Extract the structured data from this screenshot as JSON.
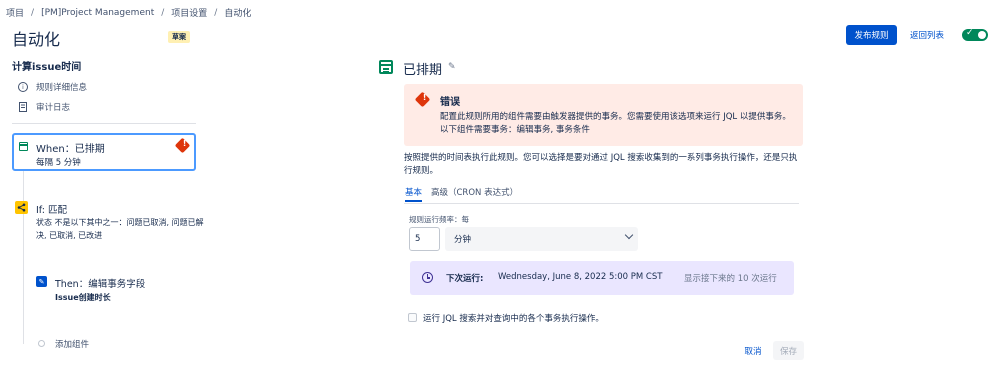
{
  "breadcrumb": {
    "items": [
      "项目",
      "[PM]Project Management",
      "项目设置",
      "自动化"
    ],
    "separator": "/"
  },
  "header": {
    "title": "自动化",
    "badge": "草案",
    "publish_label": "发布规则",
    "back_label": "返回列表",
    "toggle_on": true
  },
  "sidebar": {
    "rule_name": "计算issue时间",
    "links": [
      {
        "icon": "info-icon",
        "label": "规则详细信息"
      },
      {
        "icon": "document-icon",
        "label": "审计日志"
      }
    ],
    "components": {
      "when": {
        "title": "When：已排期",
        "sub": "每隔 5 分钟",
        "icon": "calendar-icon",
        "has_error": true
      },
      "if": {
        "title": "If: 匹配",
        "desc": "状态 不是以下其中之一：问题已取消, 问题已解决, 已取消, 已改进",
        "icon": "branch-icon"
      },
      "then": {
        "title": "Then：编辑事务字段",
        "desc": "Issue创建时长",
        "icon": "pencil-icon"
      },
      "add_label": "添加组件"
    }
  },
  "main": {
    "section_title": "已排期",
    "error": {
      "title": "错误",
      "message": "配置此规则所用的组件需要由触发器提供的事务。您需要使用该选项来运行 JQL 以提供事务。以下组件需要事务：编辑事务, 事务条件"
    },
    "description": "按照提供的时间表执行此规则。您可以选择是要对通过 JQL 搜索收集到的一系列事务执行操作，还是只执行规则。",
    "tabs": [
      {
        "label": "基本",
        "active": true
      },
      {
        "label": "高级（CRON 表达式）",
        "active": false
      }
    ],
    "frequency_label": "规则运行频率：每",
    "frequency_value": "5",
    "frequency_unit": "分钟",
    "next_run": {
      "label": "下次运行:",
      "datetime": "Wednesday, June 8, 2022 5:00 PM CST",
      "more_link": "显示接下来的 10 次运行"
    },
    "jql_checkbox_label": "运行 JQL 搜索并对查询中的各个事务执行操作。",
    "jql_checked": false,
    "cancel_label": "取消",
    "save_label": "保存"
  },
  "colors": {
    "primary": "#0052cc",
    "error": "#de350b",
    "error_bg": "#ffebe6",
    "success": "#00875a",
    "next_run_bg": "#eae6ff",
    "badge_bg": "#fff0b3"
  }
}
